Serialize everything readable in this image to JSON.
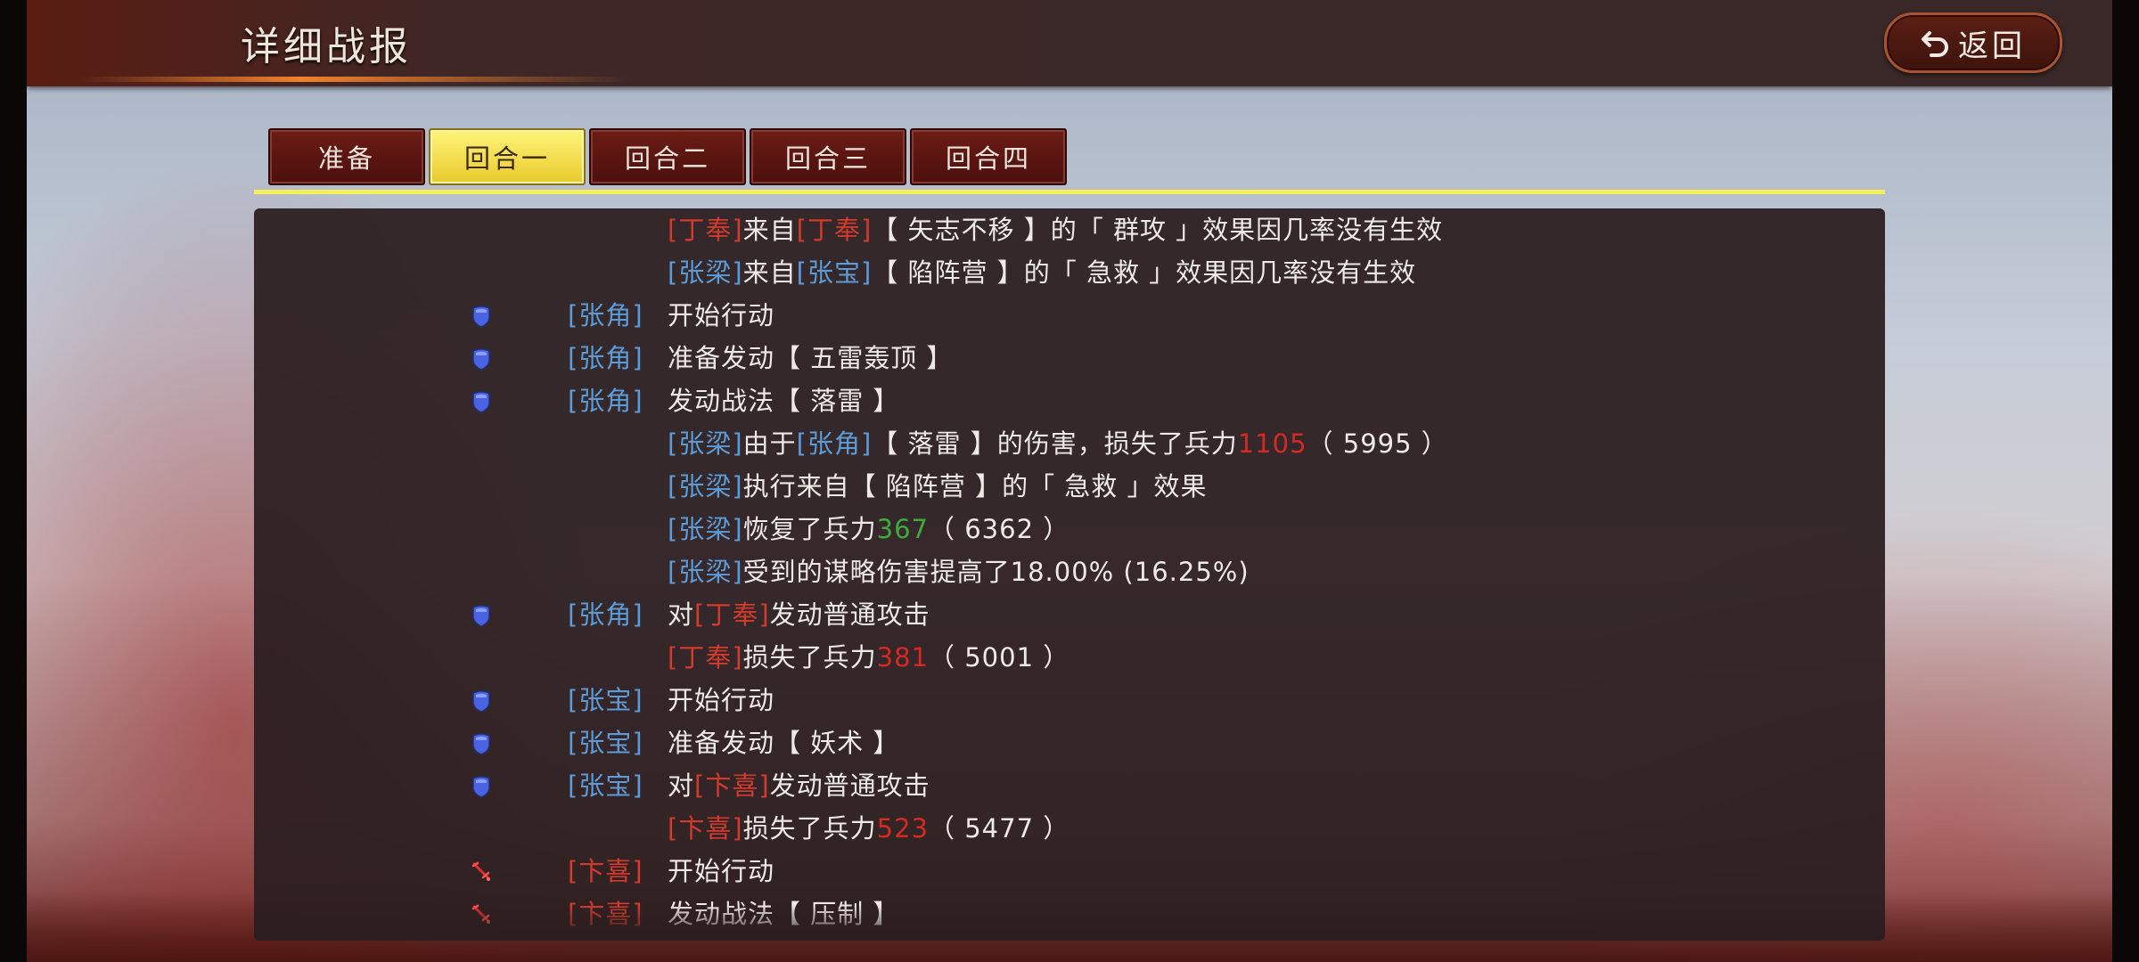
{
  "header": {
    "title": "详细战报",
    "back_label": "返回"
  },
  "tabs": [
    {
      "label": "准备",
      "active": false
    },
    {
      "label": "回合一",
      "active": true
    },
    {
      "label": "回合二",
      "active": false
    },
    {
      "label": "回合三",
      "active": false
    },
    {
      "label": "回合四",
      "active": false
    }
  ],
  "colors": {
    "ally_name": "#5d9bd8",
    "enemy_name": "#d23a2c",
    "damage": "#d22a22",
    "heal": "#3faa3c",
    "active_tab": "#f4e34c"
  },
  "log": [
    {
      "kind": "sub",
      "parts": [
        {
          "t": "[丁奉]",
          "c": "r"
        },
        {
          "t": "来自"
        },
        {
          "t": "[丁奉]",
          "c": "r"
        },
        {
          "t": "【 矢志不移 】的「 群攻 」效果因几率没有生效"
        }
      ]
    },
    {
      "kind": "sub",
      "parts": [
        {
          "t": "[张梁]",
          "c": "b"
        },
        {
          "t": "来自"
        },
        {
          "t": "[张宝]",
          "c": "b"
        },
        {
          "t": "【 陷阵营 】的「 急救 」效果因几率没有生效"
        }
      ]
    },
    {
      "kind": "main",
      "icon": "shield-icon",
      "actor": "[张角]",
      "actor_c": "b",
      "parts": [
        {
          "t": "开始行动"
        }
      ]
    },
    {
      "kind": "main",
      "icon": "shield-icon",
      "actor": "[张角]",
      "actor_c": "b",
      "parts": [
        {
          "t": "准备发动【 五雷轰顶 】"
        }
      ]
    },
    {
      "kind": "main",
      "icon": "shield-icon",
      "actor": "[张角]",
      "actor_c": "b",
      "parts": [
        {
          "t": "发动战法【 落雷 】"
        }
      ]
    },
    {
      "kind": "sub",
      "parts": [
        {
          "t": "[张梁]",
          "c": "b"
        },
        {
          "t": "由于"
        },
        {
          "t": "[张角]",
          "c": "b"
        },
        {
          "t": "【 落雷 】的伤害，损失了兵力"
        },
        {
          "t": "1105",
          "c": "dmg"
        },
        {
          "t": "（ 5995 ）"
        }
      ]
    },
    {
      "kind": "sub",
      "parts": [
        {
          "t": "[张梁]",
          "c": "b"
        },
        {
          "t": "执行来自【 陷阵营 】的「 急救 」效果"
        }
      ]
    },
    {
      "kind": "sub",
      "parts": [
        {
          "t": "[张梁]",
          "c": "b"
        },
        {
          "t": "恢复了兵力"
        },
        {
          "t": "367",
          "c": "heal"
        },
        {
          "t": "（ 6362 ）"
        }
      ]
    },
    {
      "kind": "sub",
      "parts": [
        {
          "t": "[张梁]",
          "c": "b"
        },
        {
          "t": "受到的谋略伤害提高了18.00% (16.25%)"
        }
      ]
    },
    {
      "kind": "main",
      "icon": "shield-icon",
      "actor": "[张角]",
      "actor_c": "b",
      "parts": [
        {
          "t": "对"
        },
        {
          "t": "[丁奉]",
          "c": "r"
        },
        {
          "t": "发动普通攻击"
        }
      ]
    },
    {
      "kind": "sub",
      "parts": [
        {
          "t": "[丁奉]",
          "c": "r"
        },
        {
          "t": "损失了兵力"
        },
        {
          "t": "381",
          "c": "dmg"
        },
        {
          "t": "（ 5001 ）"
        }
      ]
    },
    {
      "kind": "main",
      "icon": "shield-icon",
      "actor": "[张宝]",
      "actor_c": "b",
      "parts": [
        {
          "t": "开始行动"
        }
      ]
    },
    {
      "kind": "main",
      "icon": "shield-icon",
      "actor": "[张宝]",
      "actor_c": "b",
      "parts": [
        {
          "t": "准备发动【 妖术 】"
        }
      ]
    },
    {
      "kind": "main",
      "icon": "shield-icon",
      "actor": "[张宝]",
      "actor_c": "b",
      "parts": [
        {
          "t": "对"
        },
        {
          "t": "[卞喜]",
          "c": "r"
        },
        {
          "t": "发动普通攻击"
        }
      ]
    },
    {
      "kind": "sub",
      "parts": [
        {
          "t": "[卞喜]",
          "c": "r"
        },
        {
          "t": "损失了兵力"
        },
        {
          "t": "523",
          "c": "dmg"
        },
        {
          "t": "（ 5477 ）"
        }
      ]
    },
    {
      "kind": "main",
      "icon": "sword-icon",
      "actor": "[卞喜]",
      "actor_c": "r",
      "parts": [
        {
          "t": "开始行动"
        }
      ]
    },
    {
      "kind": "main",
      "icon": "sword-icon",
      "actor": "[卞喜]",
      "actor_c": "r",
      "parts": [
        {
          "t": "发动战法【 压制 】"
        }
      ]
    }
  ]
}
